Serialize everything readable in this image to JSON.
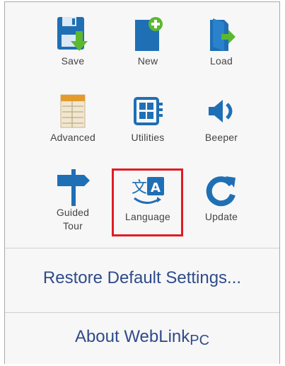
{
  "tiles": [
    {
      "id": "save",
      "label": "Save",
      "icon": "save-icon"
    },
    {
      "id": "new",
      "label": "New",
      "icon": "new-document-icon"
    },
    {
      "id": "load",
      "label": "Load",
      "icon": "load-icon"
    },
    {
      "id": "advanced",
      "label": "Advanced",
      "icon": "advanced-settings-icon"
    },
    {
      "id": "utilities",
      "label": "Utilities",
      "icon": "utilities-icon"
    },
    {
      "id": "beeper",
      "label": "Beeper",
      "icon": "speaker-icon"
    },
    {
      "id": "guided_tour",
      "label_line1": "Guided",
      "label_line2": "Tour",
      "icon": "signpost-icon"
    },
    {
      "id": "language",
      "label": "Language",
      "icon": "language-icon"
    },
    {
      "id": "update",
      "label": "Update",
      "icon": "refresh-icon"
    }
  ],
  "menu": {
    "restore_label": "Restore Default Settings...",
    "about_label": "About WebLink",
    "about_suffix": "PC"
  },
  "colors": {
    "icon_blue": "#1f6fb5",
    "icon_green": "#5cb82f",
    "highlight_red": "#e21b23",
    "menu_text": "#2f4b8a"
  }
}
